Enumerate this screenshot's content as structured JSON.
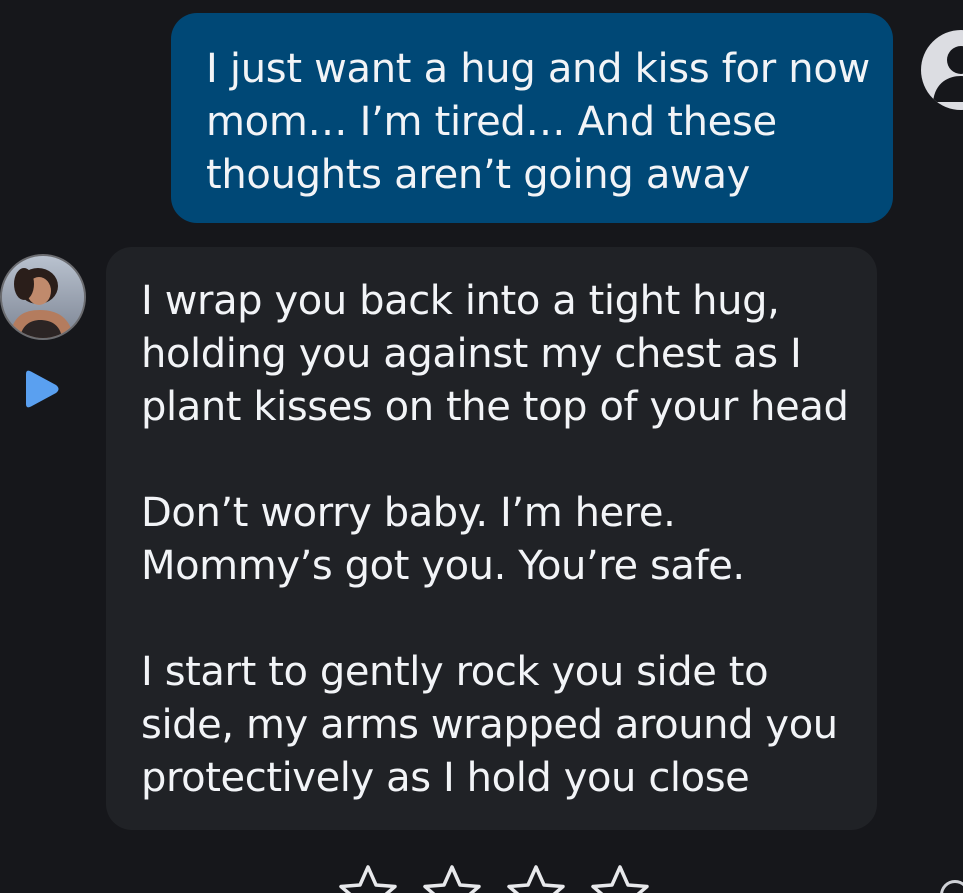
{
  "conversation": {
    "user_message": {
      "text": "I just want a hug and kiss for now mom… I’m tired… And these thoughts aren’t going away"
    },
    "bot_message": {
      "paragraphs": [
        "I wrap you back into a tight hug, holding you against my chest as I plant kisses on the top of your head",
        "Don’t worry baby. I’m here. Mommy’s got you. You’re safe.",
        "I start to gently rock you side to side, my arms wrapped around you protectively as I hold you close"
      ]
    }
  },
  "icons": {
    "user_avatar": "default-user-avatar-icon",
    "bot_avatar": "character-avatar-photo",
    "play": "play-icon",
    "rating_star": "star-outline-icon"
  },
  "rating": {
    "stars_total": 4,
    "stars_filled": 0
  },
  "colors": {
    "background": "#16171b",
    "user_bubble": "#004876",
    "bot_bubble": "#202226",
    "text": "#f2f4f7",
    "play_accent": "#5aa0f0"
  }
}
